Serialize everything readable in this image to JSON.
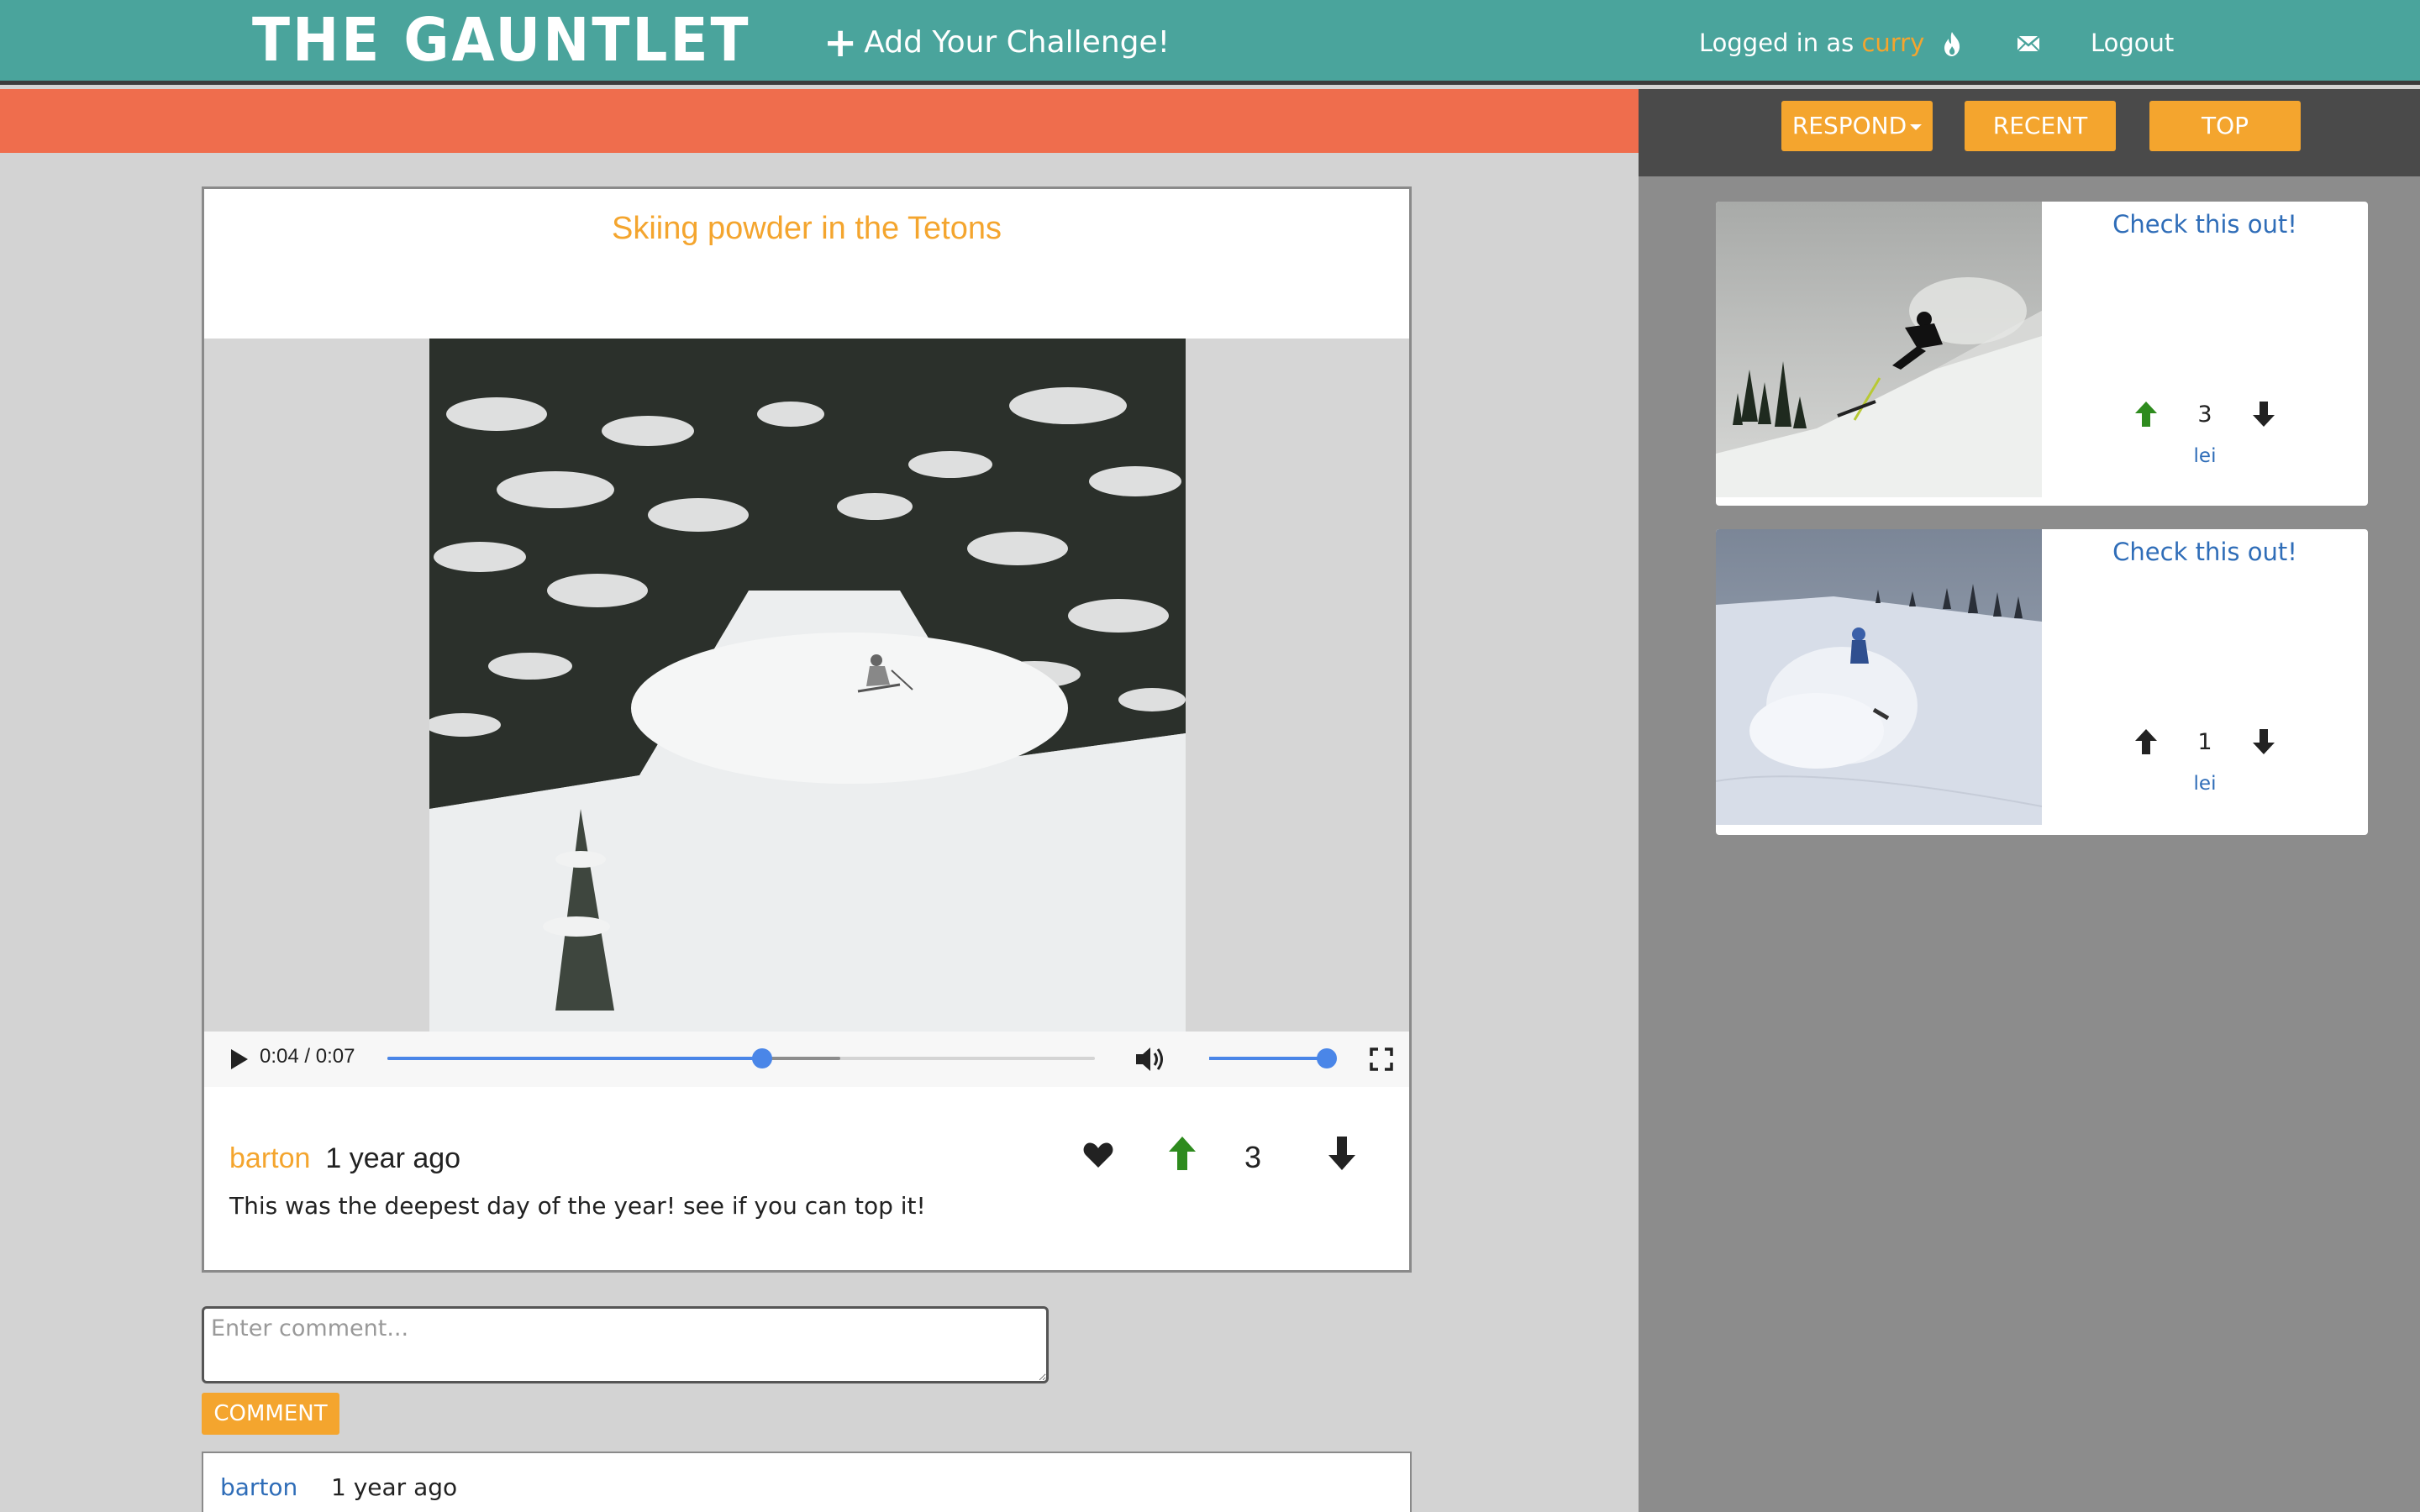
{
  "navbar": {
    "brand": "THE GAUNTLET",
    "add_challenge": "Add Your Challenge!",
    "logged_in_prefix": "Logged in as ",
    "username": "curry",
    "logout": "Logout",
    "icons": [
      "flame-icon",
      "mail-icon"
    ]
  },
  "toolbar": {
    "respond": "RESPOND",
    "recent": "RECENT",
    "top": "TOP"
  },
  "challenge": {
    "title": "Skiing powder in the Tetons",
    "author": "barton",
    "time": "1 year ago",
    "score": "3",
    "description": "This was the deepest day of the year! see if you can top it!",
    "video": {
      "time_display": "0:04 / 0:07",
      "progress_fraction": 0.53,
      "buffered_fraction": 0.64,
      "volume_fraction": 1.0
    }
  },
  "comment_form": {
    "placeholder": "Enter comment...",
    "button": "COMMENT"
  },
  "comments": [
    {
      "author": "barton",
      "time": "1 year ago"
    }
  ],
  "responses": [
    {
      "title": "Check this out!",
      "score": "3",
      "author": "lei",
      "upvoted": true
    },
    {
      "title": "Check this out!",
      "score": "1",
      "author": "lei",
      "upvoted": false
    }
  ],
  "colors": {
    "teal": "#4aa49c",
    "orange": "#f4a52e",
    "coral": "#ef6d4d",
    "link_blue": "#2f6db8",
    "upvote_green": "#2e8b1e"
  }
}
